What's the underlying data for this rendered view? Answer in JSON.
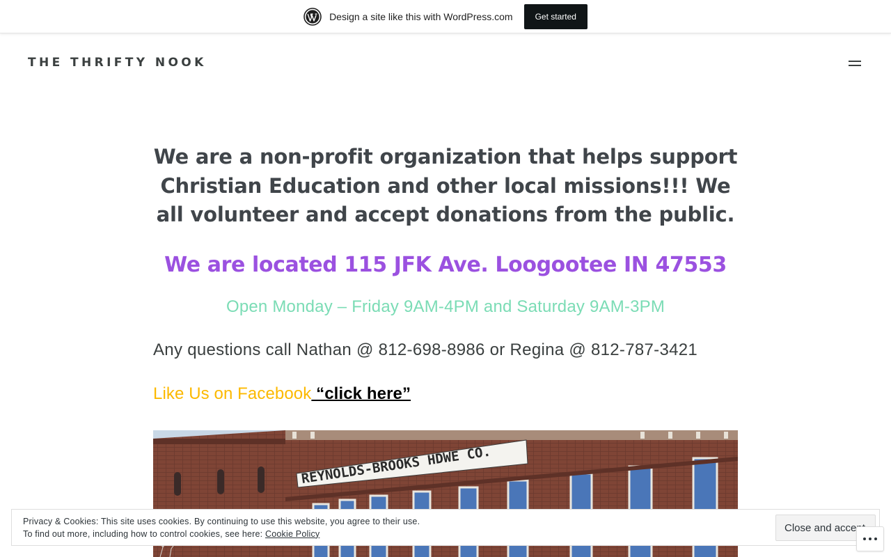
{
  "wpbar": {
    "text": "Design a site like this with WordPress.com",
    "cta": "Get started",
    "logo_icon": "wordpress-logo-icon"
  },
  "header": {
    "site_title": "THE THRIFTY NOOK",
    "menu_icon": "hamburger-menu-icon"
  },
  "main": {
    "heading": "We are a non-profit organization that helps support Christian Education and other local missions!!! We all volunteer and accept donations from the public.",
    "address": "We are located 115 JFK Ave. Loogootee IN 47553",
    "hours": "Open Monday – Friday 9AM-4PM and Saturday 9AM-3PM",
    "phone": "Any questions call Nathan @ 812-698-8986 or Regina @ 812-787-3421",
    "facebook_text": "Like Us on Facebook",
    "facebook_link": " “click here”"
  },
  "photo": {
    "sign_text": "REYNOLDS-BROOKS HDWE CO."
  },
  "cookie": {
    "line1": "Privacy & Cookies: This site uses cookies. By continuing to use this website, you agree to their use.",
    "line2_prefix": "To find out more, including how to control cookies, see here: ",
    "policy_link": "Cookie Policy",
    "accept_button": "Close and accept"
  },
  "colors": {
    "heading": "#40454a",
    "address": "#9b51e0",
    "hours": "#7bdcb5",
    "facebook": "#fcb900",
    "brick": "#8a4a3a"
  }
}
